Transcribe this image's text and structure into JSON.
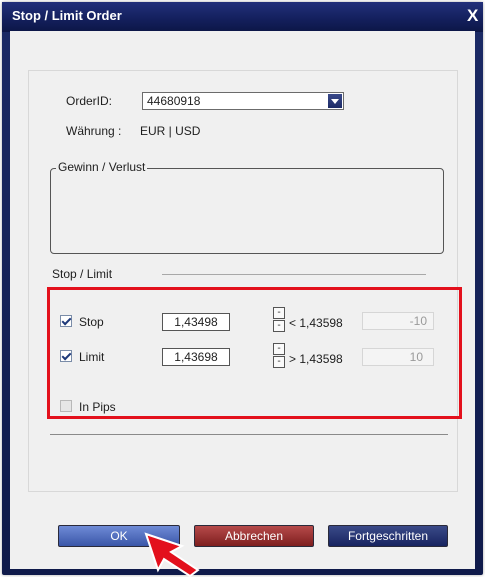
{
  "window": {
    "title": "Stop / Limit Order",
    "close_glyph": "X"
  },
  "order": {
    "id_label": "OrderID:",
    "id_value": "44680918",
    "currency_label": "Währung :",
    "currency_value": "EUR | USD"
  },
  "pnl_group": {
    "title": "Gewinn / Verlust"
  },
  "stop_limit": {
    "section_title": "Stop / Limit",
    "stop": {
      "label": "Stop",
      "checked": true,
      "value": "1,43498",
      "condition": "< 1,43598",
      "pips": "-10"
    },
    "limit": {
      "label": "Limit",
      "checked": true,
      "value": "1,43698",
      "condition": "> 1,43598",
      "pips": "10"
    },
    "in_pips": {
      "label": "In Pips",
      "checked": false
    }
  },
  "buttons": {
    "ok": "OK",
    "cancel": "Abbrechen",
    "advanced": "Fortgeschritten"
  },
  "colors": {
    "highlight": "#e3101c",
    "title_bar": "#14205e"
  }
}
